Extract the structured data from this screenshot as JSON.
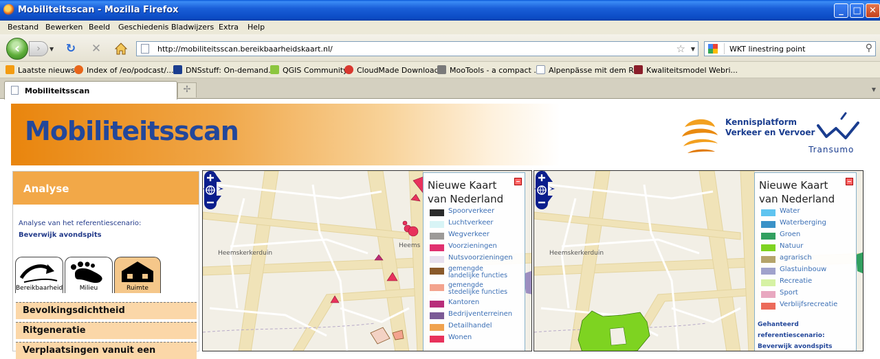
{
  "window": {
    "title": "Mobiliteitsscan - Mozilla Firefox"
  },
  "menu": [
    "Bestand",
    "Bewerken",
    "Beeld",
    "Geschiedenis",
    "Bladwijzers",
    "Extra",
    "Help"
  ],
  "nav": {
    "url": "http://mobiliteitsscan.bereikbaarheidskaart.nl/",
    "search": "WKT linestring point"
  },
  "bookmarks": [
    {
      "label": "Laatste nieuws",
      "color": "#f39c12"
    },
    {
      "label": "Index of /eo/podcast/...",
      "color": "#e8661a"
    },
    {
      "label": "DNSstuff: On-demand...",
      "color": "#1a3d8f"
    },
    {
      "label": "QGIS Community",
      "color": "#8cc63f"
    },
    {
      "label": "CloudMade Downloads",
      "color": "#d9382f"
    },
    {
      "label": "MooTools - a compact ...",
      "color": "#7a7a7a"
    },
    {
      "label": "Alpenpässe mit dem R...",
      "color": "#ffffff"
    },
    {
      "label": "Kwaliteitsmodel Webri...",
      "color": "#8a1e2a"
    }
  ],
  "tab": {
    "label": "Mobiliteitsscan"
  },
  "banner": {
    "title": "Mobiliteitsscan",
    "kp_line1": "Kennisplatform",
    "kp_line2": "Verkeer en Vervoer",
    "transumo": "Transumo"
  },
  "sidebar": {
    "header": "Analyse",
    "subtitle": "Analyse van het referentiescenario:",
    "scenario": "Beverwijk avondspits",
    "tabs": [
      "Bereikbaarheid",
      "Milieu",
      "Ruimte"
    ],
    "items": [
      "Bevolkingsdichtheid",
      "Ritgeneratie",
      "Verplaatsingen vanuit een"
    ]
  },
  "map1": {
    "place": "Heemskerkerduin",
    "place2": "Heems",
    "legend_title_1": "Nieuwe Kaart",
    "legend_title_2": "van Nederland",
    "items": [
      {
        "label": "Spoorverkeer",
        "color": "#2b2b2b"
      },
      {
        "label": "Luchtverkeer",
        "color": "#d8f4f6"
      },
      {
        "label": "Wegverkeer",
        "color": "#9c9a98"
      },
      {
        "label": "Voorzieningen",
        "color": "#e0306f"
      },
      {
        "label": "Nutsvoorzieningen",
        "color": "#e7e0ee"
      },
      {
        "label": "gemengde landelijke functies",
        "color": "#8a5a2b"
      },
      {
        "label": "gemengde stedelijke functies",
        "color": "#f3a38e"
      },
      {
        "label": "Kantoren",
        "color": "#b82e7a"
      },
      {
        "label": "Bedrijventerreinen",
        "color": "#7b5a96"
      },
      {
        "label": "Detailhandel",
        "color": "#f0a24f"
      },
      {
        "label": "Wonen",
        "color": "#e8325c"
      }
    ]
  },
  "map2": {
    "place": "Heemskerkerduin",
    "legend_title_1": "Nieuwe Kaart",
    "legend_title_2": "van Nederland",
    "items": [
      {
        "label": "Water",
        "color": "#5fc4f0"
      },
      {
        "label": "Waterberging",
        "color": "#3a92c8"
      },
      {
        "label": "Groen",
        "color": "#32a060"
      },
      {
        "label": "Natuur",
        "color": "#7ed321"
      },
      {
        "label": "agrarisch",
        "color": "#b5a46a"
      },
      {
        "label": "Glastuinbouw",
        "color": "#a0a2cc"
      },
      {
        "label": "Recreatie",
        "color": "#d6f2a4"
      },
      {
        "label": "Sport",
        "color": "#e8a8c0"
      },
      {
        "label": "Verblijfsrecreatie",
        "color": "#ec6a5a"
      }
    ],
    "note_1": "Gehanteerd",
    "note_2": "referentiescenario:",
    "note_3": "Beverwijk avondspits"
  }
}
